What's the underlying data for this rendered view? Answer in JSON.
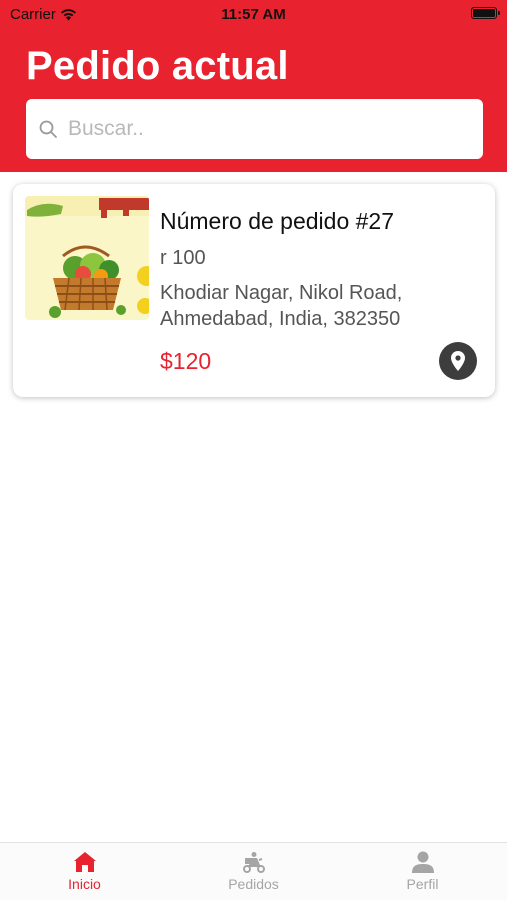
{
  "status_bar": {
    "carrier": "Carrier",
    "time": "11:57 AM"
  },
  "header": {
    "title": "Pedido actual",
    "background_color": "#e8232f"
  },
  "search": {
    "placeholder": "Buscar..",
    "value": ""
  },
  "orders": [
    {
      "number_label": "Número de pedido #27",
      "subtitle": "r 100",
      "address": "Khodiar Nagar, Nikol Road, Ahmedabad, India, 382350",
      "price": "$120",
      "image_icon": "vegetable-basket-icon",
      "action_icon": "location-pin-icon"
    }
  ],
  "tab_bar": {
    "active_color": "#e8232f",
    "inactive_color": "#a5a5a5",
    "tabs": [
      {
        "label": "Inicio",
        "icon": "home-icon",
        "active": true
      },
      {
        "label": "Pedidos",
        "icon": "delivery-scooter-icon",
        "active": false
      },
      {
        "label": "Perfil",
        "icon": "user-icon",
        "active": false
      }
    ]
  }
}
